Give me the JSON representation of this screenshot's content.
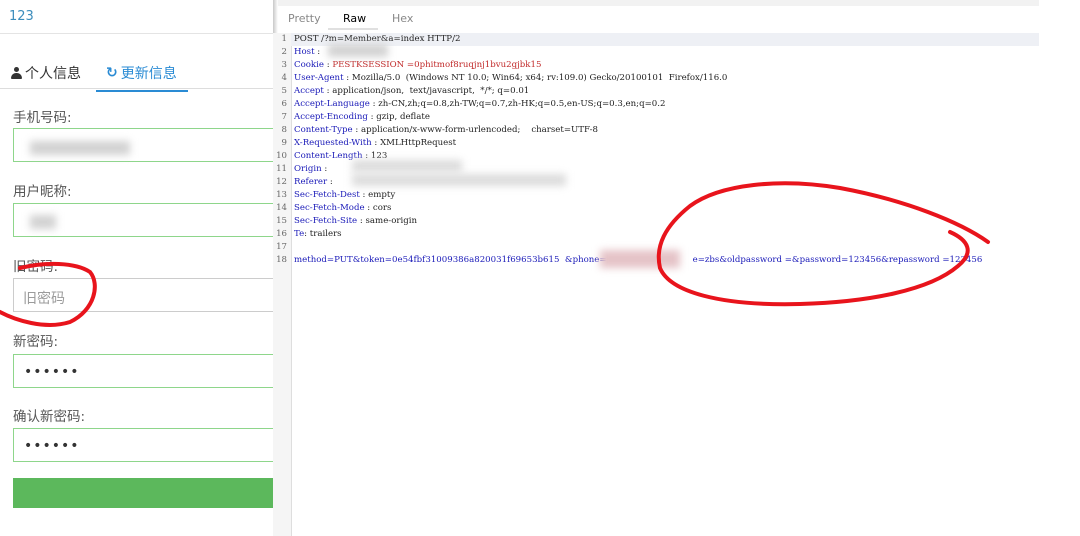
{
  "form": {
    "header_text": "123",
    "tabs": [
      {
        "label": "个人信息",
        "icon": "user-icon"
      },
      {
        "label": "更新信息",
        "icon": "refresh-icon"
      }
    ],
    "fields": [
      {
        "label": "手机号码:",
        "value": ""
      },
      {
        "label": "用户昵称:",
        "value": ""
      },
      {
        "label": "旧密码:",
        "placeholder": "旧密码"
      },
      {
        "label": "新密码:",
        "value": "••••••"
      },
      {
        "label": "确认新密码:",
        "value": "••••••"
      }
    ]
  },
  "request": {
    "view_tabs": [
      "Pretty",
      "Raw",
      "Hex"
    ],
    "active_tab": "Raw",
    "lines": [
      {
        "n": "1",
        "text": "POST /?m=Member&a=index HTTP/2"
      },
      {
        "n": "2",
        "key": "Host",
        "value": ""
      },
      {
        "n": "3",
        "key": "Cookie",
        "value": "PESTKSESSION =0phitmof8ruqjnj1bvu2gjbk15"
      },
      {
        "n": "4",
        "key": "User-Agent",
        "value": "Mozilla/5.0  (Windows NT 10.0; Win64; x64; rv:109.0) Gecko/20100101  Firefox/116.0"
      },
      {
        "n": "5",
        "key": "Accept",
        "value": "application/json,  text/javascript,  */*; q=0.01"
      },
      {
        "n": "6",
        "key": "Accept-Language",
        "value": "zh-CN,zh;q=0.8,zh-TW;q=0.7,zh-HK;q=0.5,en-US;q=0.3,en;q=0.2"
      },
      {
        "n": "7",
        "key": "Accept-Encoding",
        "value": "gzip, deflate"
      },
      {
        "n": "8",
        "key": "Content-Type",
        "value": "application/x-www-form-urlencoded;    charset=UTF-8"
      },
      {
        "n": "9",
        "key": "X-Requested-With",
        "value": "XMLHttpRequest"
      },
      {
        "n": "10",
        "key": "Content-Length",
        "value": "123"
      },
      {
        "n": "11",
        "key": "Origin",
        "value": ""
      },
      {
        "n": "12",
        "key": "Referer",
        "value": ""
      },
      {
        "n": "13",
        "key": "Sec-Fetch-Dest",
        "value": "empty"
      },
      {
        "n": "14",
        "key": "Sec-Fetch-Mode",
        "value": "cors"
      },
      {
        "n": "15",
        "key": "Sec-Fetch-Site",
        "value": "same-origin"
      },
      {
        "n": "16",
        "key": "Te",
        "value": "trailers"
      },
      {
        "n": "17",
        "text": ""
      },
      {
        "n": "18",
        "body_a": "method=PUT&token=0e54fbf31009386a820031f69653b615  &phone=",
        "body_b": "e=zbs&oldpassword =&password=123456&repassword =123456"
      }
    ]
  },
  "colors": {
    "accent_blue": "#2a8bd4",
    "input_border_green": "#8ed68b",
    "submit_green": "#5cb85c",
    "annotation_red": "#e8141c"
  }
}
